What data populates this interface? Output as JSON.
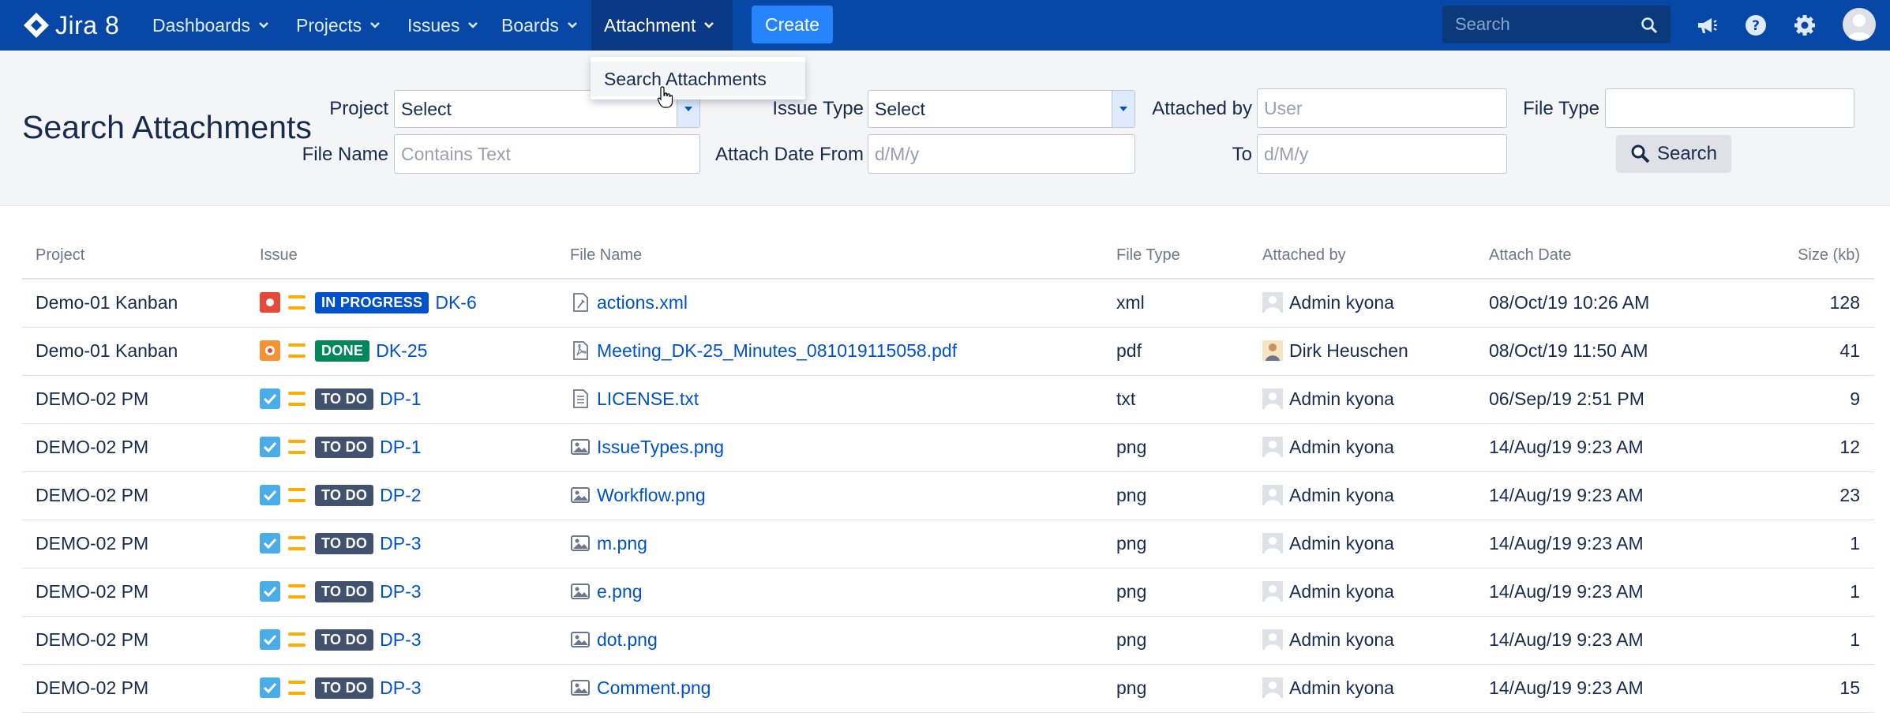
{
  "nav": {
    "logo_text": "Jira 8",
    "items": [
      {
        "label": "Dashboards"
      },
      {
        "label": "Projects"
      },
      {
        "label": "Issues"
      },
      {
        "label": "Boards"
      },
      {
        "label": "Attachment"
      }
    ],
    "create_label": "Create",
    "search_placeholder": "Search"
  },
  "dropdown": {
    "item_label": "Search Attachments"
  },
  "filters": {
    "page_title": "Search Attachments",
    "project_label": "Project",
    "project_value": "Select",
    "issue_type_label": "Issue Type",
    "issue_type_value": "Select",
    "attached_by_label": "Attached by",
    "attached_by_placeholder": "User",
    "file_type_label": "File Type",
    "file_type_value": "",
    "file_name_label": "File Name",
    "file_name_placeholder": "Contains Text",
    "attach_date_from_label": "Attach Date From",
    "attach_date_from_placeholder": "d/M/y",
    "to_label": "To",
    "to_placeholder": "d/M/y",
    "search_button_label": "Search"
  },
  "table": {
    "headers": [
      "Project",
      "Issue",
      "File Name",
      "File Type",
      "Attached by",
      "Attach Date",
      "Size (kb)"
    ],
    "rows": [
      {
        "project": "Demo-01 Kanban",
        "issue_type": "bug",
        "status": "IN PROGRESS",
        "status_color": "#0052cc",
        "key": "DK-6",
        "file_icon": "xml-file-icon",
        "file_name": "actions.xml",
        "file_type": "xml",
        "attached_by": "Admin kyona",
        "user_avatar": "default",
        "date": "08/Oct/19 10:26 AM",
        "size": "128"
      },
      {
        "project": "Demo-01 Kanban",
        "issue_type": "bug-orange",
        "status": "DONE",
        "status_color": "#00875a",
        "key": "DK-25",
        "file_icon": "pdf-file-icon",
        "file_name": "Meeting_DK-25_Minutes_081019115058.pdf",
        "file_type": "pdf",
        "attached_by": "Dirk Heuschen",
        "user_avatar": "photo",
        "date": "08/Oct/19 11:50 AM",
        "size": "41"
      },
      {
        "project": "DEMO-02 PM",
        "issue_type": "task",
        "status": "TO DO",
        "status_color": "#42526e",
        "key": "DP-1",
        "file_icon": "text-file-icon",
        "file_name": "LICENSE.txt",
        "file_type": "txt",
        "attached_by": "Admin kyona",
        "user_avatar": "default",
        "date": "06/Sep/19 2:51 PM",
        "size": "9"
      },
      {
        "project": "DEMO-02 PM",
        "issue_type": "task",
        "status": "TO DO",
        "status_color": "#42526e",
        "key": "DP-1",
        "file_icon": "image-file-icon",
        "file_name": "IssueTypes.png",
        "file_type": "png",
        "attached_by": "Admin kyona",
        "user_avatar": "default",
        "date": "14/Aug/19 9:23 AM",
        "size": "12"
      },
      {
        "project": "DEMO-02 PM",
        "issue_type": "task",
        "status": "TO DO",
        "status_color": "#42526e",
        "key": "DP-2",
        "file_icon": "image-file-icon",
        "file_name": "Workflow.png",
        "file_type": "png",
        "attached_by": "Admin kyona",
        "user_avatar": "default",
        "date": "14/Aug/19 9:23 AM",
        "size": "23"
      },
      {
        "project": "DEMO-02 PM",
        "issue_type": "task",
        "status": "TO DO",
        "status_color": "#42526e",
        "key": "DP-3",
        "file_icon": "image-file-icon",
        "file_name": "m.png",
        "file_type": "png",
        "attached_by": "Admin kyona",
        "user_avatar": "default",
        "date": "14/Aug/19 9:23 AM",
        "size": "1"
      },
      {
        "project": "DEMO-02 PM",
        "issue_type": "task",
        "status": "TO DO",
        "status_color": "#42526e",
        "key": "DP-3",
        "file_icon": "image-file-icon",
        "file_name": "e.png",
        "file_type": "png",
        "attached_by": "Admin kyona",
        "user_avatar": "default",
        "date": "14/Aug/19 9:23 AM",
        "size": "1"
      },
      {
        "project": "DEMO-02 PM",
        "issue_type": "task",
        "status": "TO DO",
        "status_color": "#42526e",
        "key": "DP-3",
        "file_icon": "image-file-icon",
        "file_name": "dot.png",
        "file_type": "png",
        "attached_by": "Admin kyona",
        "user_avatar": "default",
        "date": "14/Aug/19 9:23 AM",
        "size": "1"
      },
      {
        "project": "DEMO-02 PM",
        "issue_type": "task",
        "status": "TO DO",
        "status_color": "#42526e",
        "key": "DP-3",
        "file_icon": "image-file-icon",
        "file_name": "Comment.png",
        "file_type": "png",
        "attached_by": "Admin kyona",
        "user_avatar": "default",
        "date": "14/Aug/19 9:23 AM",
        "size": "15"
      }
    ]
  }
}
